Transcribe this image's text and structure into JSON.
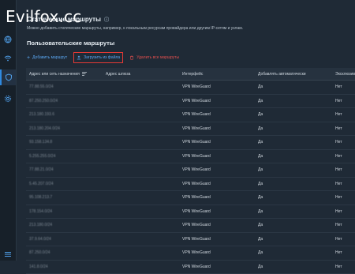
{
  "watermark": "Evilfox.cc",
  "page": {
    "title": "Статические маршруты",
    "description": "Можно добавить статические маршруты, например, к локальным ресурсам провайдера или другим IP-сетям и узлам.",
    "section_title": "Пользовательские маршруты"
  },
  "toolbar": {
    "add_label": "Добавить маршрут",
    "load_label": "Загрузить из файла",
    "delete_label": "Удалить все маршруты"
  },
  "table": {
    "columns": [
      "Адрес или сеть назначения",
      "Адрес шлюза",
      "Интерфейс",
      "Добавлять автоматически",
      "Эксклюзив"
    ],
    "rows": [
      {
        "dest": "77.88.55.0/24",
        "gateway": "",
        "iface": "VPN WireGuard",
        "auto": "Да",
        "excl": "Нет"
      },
      {
        "dest": "87.250.250.0/24",
        "gateway": "",
        "iface": "VPN WireGuard",
        "auto": "Да",
        "excl": "Нет"
      },
      {
        "dest": "213.180.193.6",
        "gateway": "",
        "iface": "VPN WireGuard",
        "auto": "Да",
        "excl": "Нет"
      },
      {
        "dest": "213.180.204.0/24",
        "gateway": "",
        "iface": "VPN WireGuard",
        "auto": "Да",
        "excl": "Нет"
      },
      {
        "dest": "93.158.134.8",
        "gateway": "",
        "iface": "VPN WireGuard",
        "auto": "Да",
        "excl": "Нет"
      },
      {
        "dest": "5.255.255.0/24",
        "gateway": "",
        "iface": "VPN WireGuard",
        "auto": "Да",
        "excl": "Нет"
      },
      {
        "dest": "77.88.21.0/24",
        "gateway": "",
        "iface": "VPN WireGuard",
        "auto": "Да",
        "excl": "Нет"
      },
      {
        "dest": "5.45.207.0/24",
        "gateway": "",
        "iface": "VPN WireGuard",
        "auto": "Да",
        "excl": "Нет"
      },
      {
        "dest": "95.108.213.7",
        "gateway": "",
        "iface": "VPN WireGuard",
        "auto": "Да",
        "excl": "Нет"
      },
      {
        "dest": "178.154.0/24",
        "gateway": "",
        "iface": "VPN WireGuard",
        "auto": "Да",
        "excl": "Нет"
      },
      {
        "dest": "213.180.0/24",
        "gateway": "",
        "iface": "VPN WireGuard",
        "auto": "Да",
        "excl": "Нет"
      },
      {
        "dest": "37.9.64.0/24",
        "gateway": "",
        "iface": "VPN WireGuard",
        "auto": "Да",
        "excl": "Нет"
      },
      {
        "dest": "87.250.0/24",
        "gateway": "",
        "iface": "VPN WireGuard",
        "auto": "Да",
        "excl": "Нет"
      },
      {
        "dest": "141.8.0/24",
        "gateway": "",
        "iface": "VPN WireGuard",
        "auto": "Да",
        "excl": "Нет"
      }
    ]
  },
  "colors": {
    "background": "#1f2a36",
    "accent": "#2f8ae0",
    "danger": "#e04e4e",
    "highlight_border": "#e53935"
  }
}
